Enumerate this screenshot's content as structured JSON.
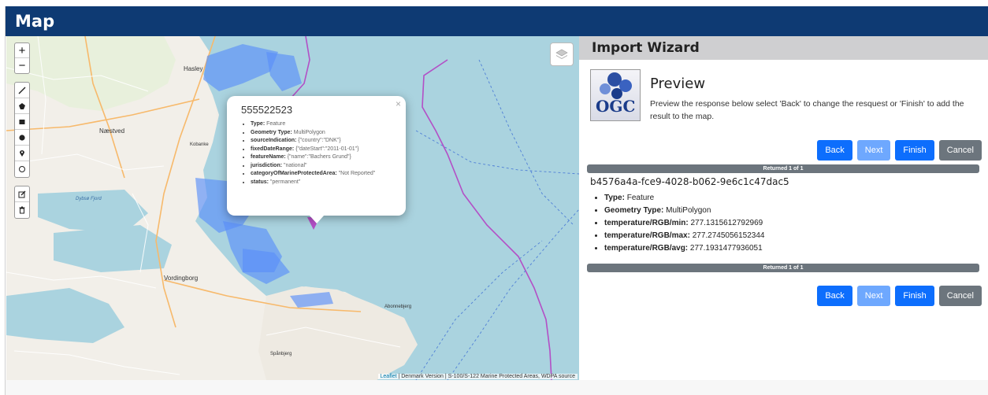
{
  "header": {
    "title": "Map"
  },
  "map": {
    "zoom_in": "+",
    "zoom_out": "−",
    "draw_tools": [
      "polyline-icon",
      "polygon-icon",
      "rectangle-icon",
      "circle-icon",
      "marker-icon",
      "circlemarker-icon"
    ],
    "edit_tools": [
      "edit-icon",
      "delete-icon"
    ],
    "place_labels": [
      "Hasley",
      "Næstved",
      "Vordingborg",
      "Kobanke",
      "Abonnebjerg",
      "Spånbjerg",
      "Dybsø Fjord"
    ],
    "attribution": {
      "link": "Leaflet",
      "text": " | Denmark Version | S-100/S-122 Marine Protected Areas, WDPA source"
    },
    "popup": {
      "title": "555522523",
      "close": "×",
      "items": [
        {
          "key": "Type:",
          "value": "Feature"
        },
        {
          "key": "Geometry Type:",
          "value": "MultiPolygon"
        },
        {
          "key": "sourceIndication:",
          "value": "{\"country\":\"DNK\"}"
        },
        {
          "key": "fixedDateRange:",
          "value": "{\"dateStart\":\"2011-01-01\"}"
        },
        {
          "key": "featureName:",
          "value": "{\"name\":\"Bachers Grund\"}"
        },
        {
          "key": "jurisdiction:",
          "value": "\"national\""
        },
        {
          "key": "categoryOfMarineProtectedArea:",
          "value": "\"Not Reported\""
        },
        {
          "key": "status:",
          "value": "\"permanent\""
        }
      ]
    }
  },
  "wizard": {
    "title": "Import Wizard",
    "logo_text": "OGC",
    "preview_title": "Preview",
    "preview_desc": "Preview the response below select 'Back' to change the resquest or 'Finish' to add the result to the map.",
    "buttons": {
      "back": "Back",
      "next": "Next",
      "finish": "Finish",
      "cancel": "Cancel"
    },
    "progress_label": "Returned 1 of 1",
    "feature_id": "b4576a4a-fce9-4028-b062-9e6c1c47dac5",
    "properties": [
      {
        "key": "Type:",
        "value": "Feature"
      },
      {
        "key": "Geometry Type:",
        "value": "MultiPolygon"
      },
      {
        "key": "temperature/RGB/min:",
        "value": "277.1315612792969"
      },
      {
        "key": "temperature/RGB/max:",
        "value": "277.2745056152344"
      },
      {
        "key": "temperature/RGB/avg:",
        "value": "277.1931477936051"
      }
    ]
  },
  "colors": {
    "header_bg": "#0e3a73",
    "sea": "#aad3df",
    "land": "#f2efe9",
    "protected_area": "#5b8ff9",
    "boundary": "#b34fc6",
    "primary_button": "#0d6efd",
    "secondary_button": "#6c757d"
  }
}
